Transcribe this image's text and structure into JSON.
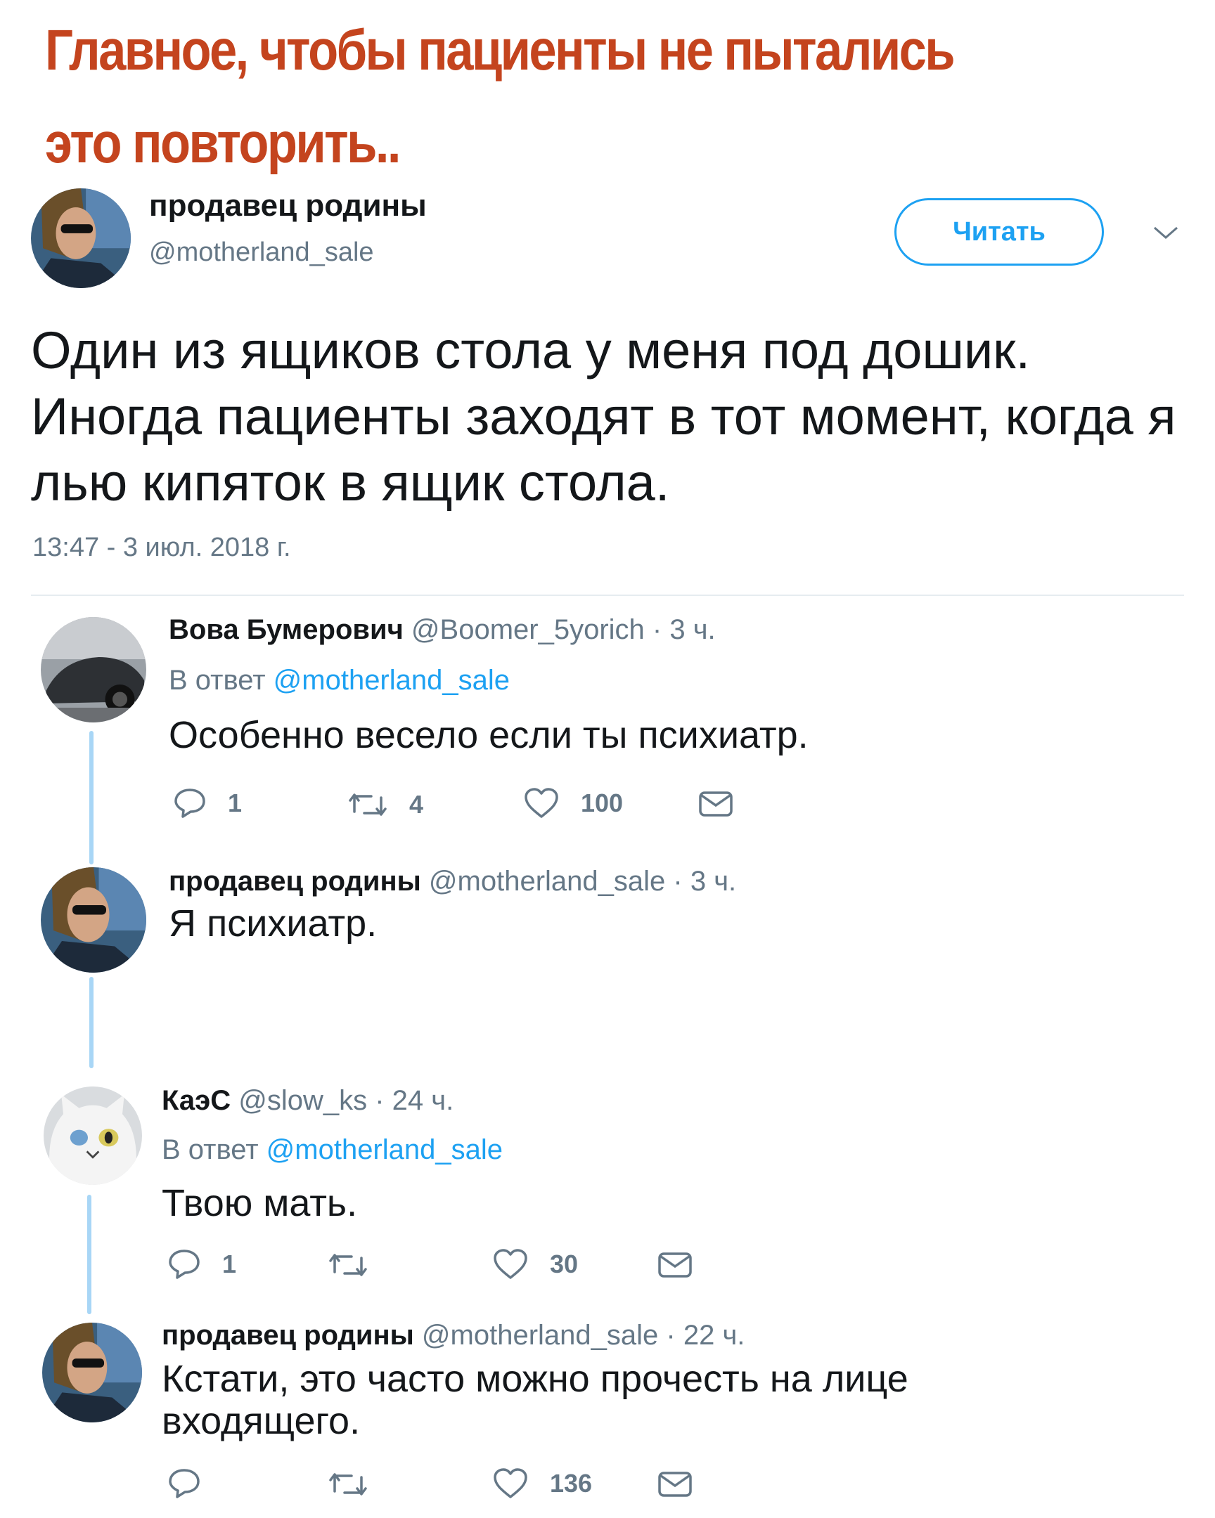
{
  "caption": "Главное, чтобы пациенты не пытались это повторить..",
  "main_tweet": {
    "display_name": "продавец родины",
    "handle": "@motherland_sale",
    "follow_label": "Читать",
    "text": "Один из ящиков стола у меня под дошик. Иногда пациенты заходят в тот момент, когда я лью кипяток в ящик стола.",
    "timestamp": "13:47 - 3 июл. 2018 г."
  },
  "replies": [
    {
      "display_name": "Вова Бумерович",
      "handle": "@Boomer_5yorich",
      "time": "· 3 ч.",
      "reply_prefix": "В ответ",
      "reply_to": "@motherland_sale",
      "text": "Особенно весело если ты психиатр.",
      "reply_count": "1",
      "retweet_count": "4",
      "like_count": "100"
    },
    {
      "display_name": "продавец родины",
      "handle": "@motherland_sale",
      "time": "· 3 ч.",
      "text": "Я психиатр."
    },
    {
      "display_name": "КаэС",
      "handle": "@slow_ks",
      "time": "· 24 ч.",
      "reply_prefix": "В ответ",
      "reply_to": "@motherland_sale",
      "text": "Твою мать.",
      "reply_count": "1",
      "retweet_count": "",
      "like_count": "30"
    },
    {
      "display_name": "продавец родины",
      "handle": "@motherland_sale",
      "time": "· 22 ч.",
      "text_line1": "Кстати, это часто можно прочесть на лице",
      "text_line2": "входящего.",
      "reply_count": "",
      "retweet_count": "",
      "like_count": "136"
    }
  ],
  "icons": {
    "reply": "speech-bubble-icon",
    "retweet": "retweet-arrows-icon",
    "like": "heart-icon",
    "dm": "envelope-icon",
    "menu": "chevron-down-icon"
  },
  "colors": {
    "caption": "#c4441e",
    "link": "#1da1f2",
    "secondary_text": "#657786",
    "thread_line": "#a8d6f6"
  }
}
